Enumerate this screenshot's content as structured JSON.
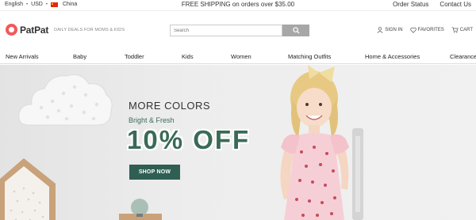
{
  "topbar": {
    "language": "English",
    "currency": "USD",
    "country": "China",
    "promo": "FREE SHIPPING on orders over $35.00",
    "order_status": "Order Status",
    "contact_us": "Contact Us"
  },
  "header": {
    "logo_text": "PatPat",
    "tagline": "DAILY DEALS FOR MOMS & KIDS",
    "search_placeholder": "Search",
    "sign_in": "SIGN IN",
    "favorites": "FAVORITES",
    "cart": "CART"
  },
  "nav": {
    "items": [
      "New Arrivals",
      "Baby",
      "Toddler",
      "Kids",
      "Women",
      "Matching Outfits",
      "Home & Accessories",
      "Clearance"
    ]
  },
  "hero": {
    "title": "MORE COLORS",
    "subtitle": "Bright & Fresh",
    "headline": "10% OFF",
    "cta": "SHOP NOW"
  },
  "colors": {
    "brand": "#f15a5a",
    "accent_green": "#3a6a58",
    "button_green": "#2f5f53"
  }
}
